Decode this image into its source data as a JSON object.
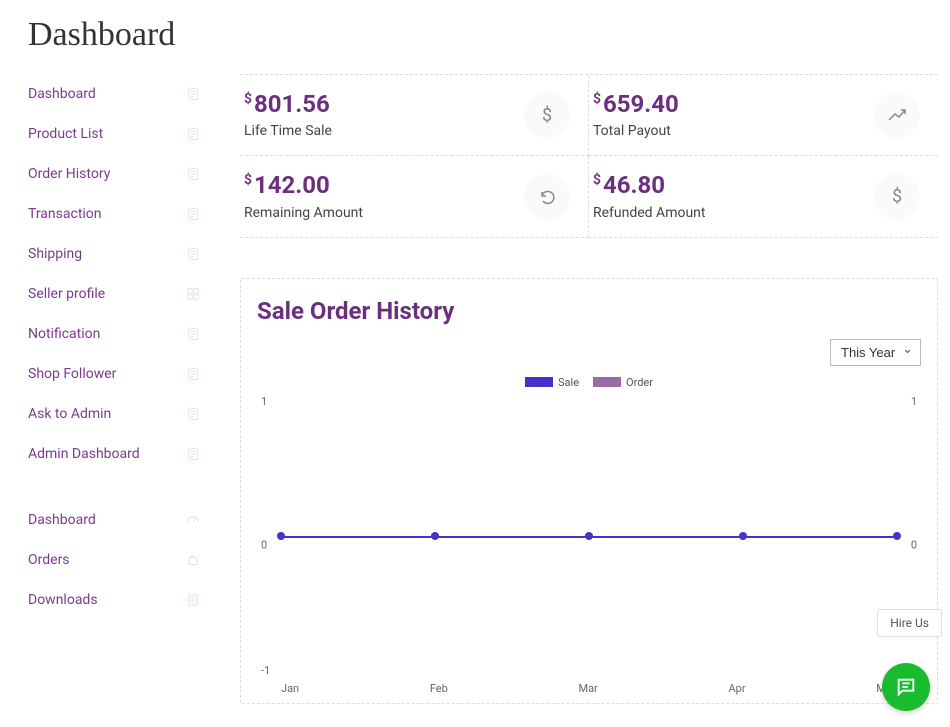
{
  "page_title": "Dashboard",
  "sidebar": {
    "group1": [
      {
        "label": "Dashboard"
      },
      {
        "label": "Product List"
      },
      {
        "label": "Order History"
      },
      {
        "label": "Transaction"
      },
      {
        "label": "Shipping"
      },
      {
        "label": "Seller profile"
      },
      {
        "label": "Notification"
      },
      {
        "label": "Shop Follower"
      },
      {
        "label": "Ask to Admin"
      },
      {
        "label": "Admin Dashboard"
      }
    ],
    "group2": [
      {
        "label": "Dashboard"
      },
      {
        "label": "Orders"
      },
      {
        "label": "Downloads"
      }
    ]
  },
  "stats": [
    {
      "currency": "$",
      "value": "801.56",
      "label": "Life Time Sale",
      "icon": "dollar"
    },
    {
      "currency": "$",
      "value": "659.40",
      "label": "Total Payout",
      "icon": "trend"
    },
    {
      "currency": "$",
      "value": "142.00",
      "label": "Remaining Amount",
      "icon": "undo"
    },
    {
      "currency": "$",
      "value": "46.80",
      "label": "Refunded Amount",
      "icon": "dollar"
    }
  ],
  "chart": {
    "title": "Sale Order History",
    "period_selected": "This Year",
    "legend": [
      {
        "label": "Sale",
        "color": "#4a2fc9"
      },
      {
        "label": "Order",
        "color": "#9c6aa8"
      }
    ]
  },
  "chart_data": {
    "type": "line",
    "title": "Sale Order History",
    "categories": [
      "Jan",
      "Feb",
      "Mar",
      "Apr",
      "May"
    ],
    "series": [
      {
        "name": "Sale",
        "values": [
          0,
          0,
          0,
          0,
          0
        ]
      },
      {
        "name": "Order",
        "values": [
          0,
          0,
          0,
          0,
          0
        ]
      }
    ],
    "ylim_left": [
      -1,
      1
    ],
    "ylim_right": [
      -1,
      1
    ],
    "xlabel": "",
    "ylabel": ""
  },
  "hire_us": "Hire Us"
}
